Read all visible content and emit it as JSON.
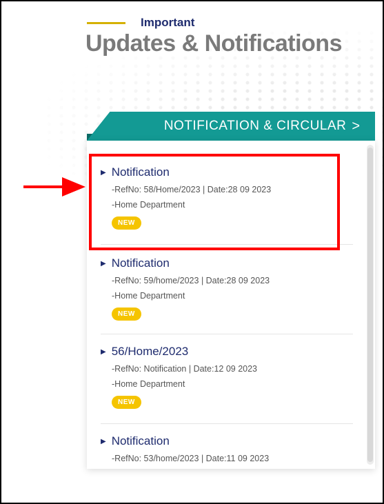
{
  "section": {
    "eyebrow": "Important",
    "title": "Updates & Notifications",
    "tab_label": "NOTIFICATION & CIRCULAR",
    "tab_chevron": ">"
  },
  "items": [
    {
      "title": "Notification",
      "ref": "-RefNo: 58/Home/2023 | Date:28 09 2023",
      "dept": "-Home Department",
      "badge": "NEW"
    },
    {
      "title": "Notification",
      "ref": "-RefNo: 59/home/2023 | Date:28 09 2023",
      "dept": "-Home Department",
      "badge": "NEW"
    },
    {
      "title": "56/Home/2023",
      "ref": "-RefNo: Notification | Date:12 09 2023",
      "dept": "-Home Department",
      "badge": "NEW"
    },
    {
      "title": "Notification",
      "ref": "-RefNo: 53/home/2023 | Date:11 09 2023"
    }
  ],
  "colors": {
    "accent": "#139a94",
    "badge": "#f5c400",
    "annotation": "#ff0000"
  },
  "icons": {
    "bullet": "caret-right-icon",
    "annotation": "red-arrow-icon"
  }
}
